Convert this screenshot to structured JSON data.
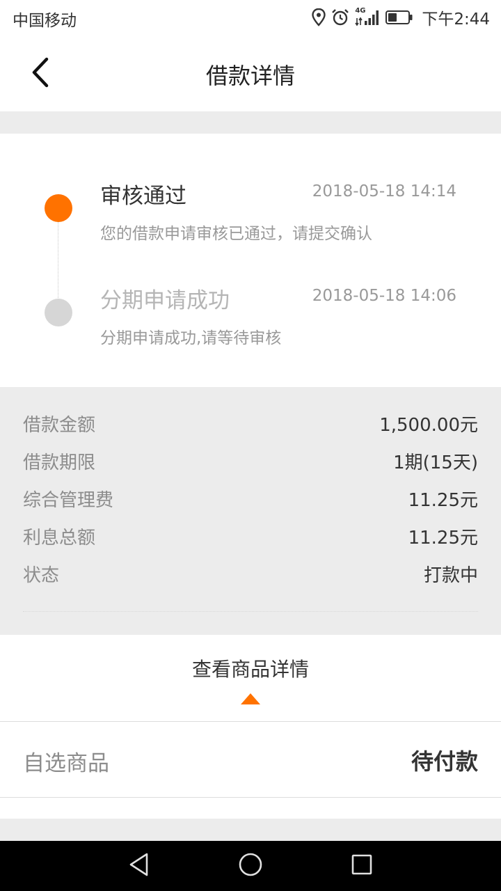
{
  "status_bar": {
    "carrier": "中国移动",
    "network": "4G",
    "time": "下午2:44"
  },
  "nav": {
    "title": "借款详情"
  },
  "timeline": [
    {
      "title": "审核通过",
      "time": "2018-05-18 14:14",
      "desc": "您的借款申请审核已通过，请提交确认",
      "active": true
    },
    {
      "title": "分期申请成功",
      "time": "2018-05-18 14:06",
      "desc": "分期申请成功,请等待审核",
      "active": false
    }
  ],
  "loan_info": [
    {
      "label": "借款金额",
      "value": "1,500.00元"
    },
    {
      "label": "借款期限",
      "value": "1期(15天)"
    },
    {
      "label": "综合管理费",
      "value": "11.25元"
    },
    {
      "label": "利息总额",
      "value": "11.25元"
    },
    {
      "label": "状态",
      "value": "打款中"
    }
  ],
  "goods_toggle": {
    "label": "查看商品详情"
  },
  "product": {
    "name": "自选商品",
    "status": "待付款"
  },
  "colors": {
    "accent": "#ff7200",
    "inactive_dot": "#d6d6d6",
    "panel_bg": "#ececec"
  },
  "icons": {
    "back": "chevron-left-icon",
    "location": "location-pin-icon",
    "alarm": "alarm-clock-icon",
    "signal": "signal-icon",
    "battery": "battery-icon",
    "nav_back": "triangle-back-icon",
    "nav_home": "circle-home-icon",
    "nav_recent": "square-recent-icon"
  }
}
